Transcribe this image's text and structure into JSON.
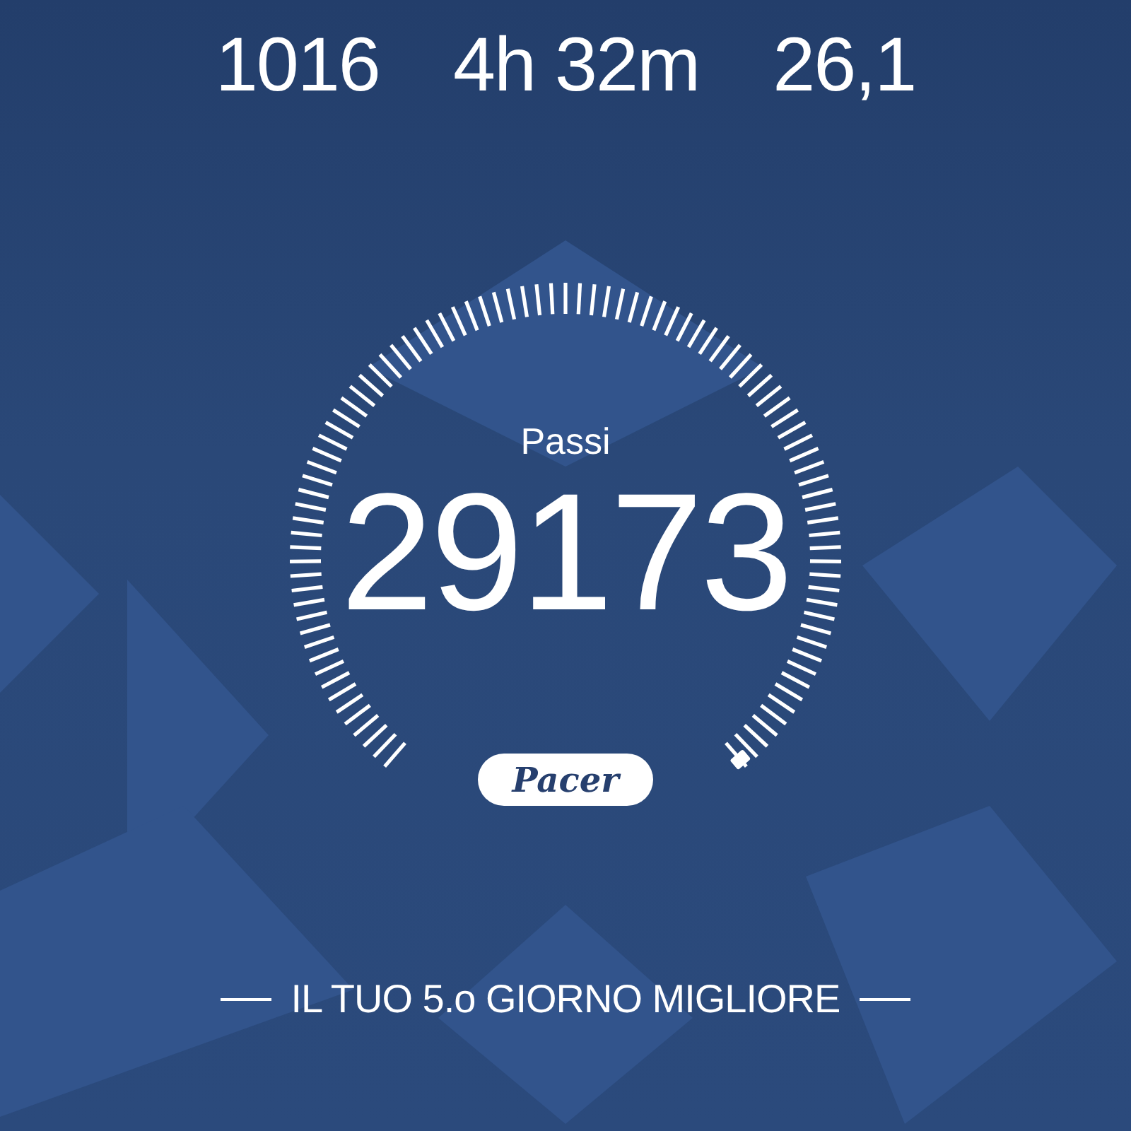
{
  "stats": [
    {
      "value": "1016"
    },
    {
      "value": "4h 32m"
    },
    {
      "value": "26,1"
    }
  ],
  "gauge": {
    "label": "Passi",
    "value": "29173",
    "badge": "Pacer"
  },
  "footer": {
    "text": "IL TUO 5.o GIORNO MIGLIORE"
  }
}
